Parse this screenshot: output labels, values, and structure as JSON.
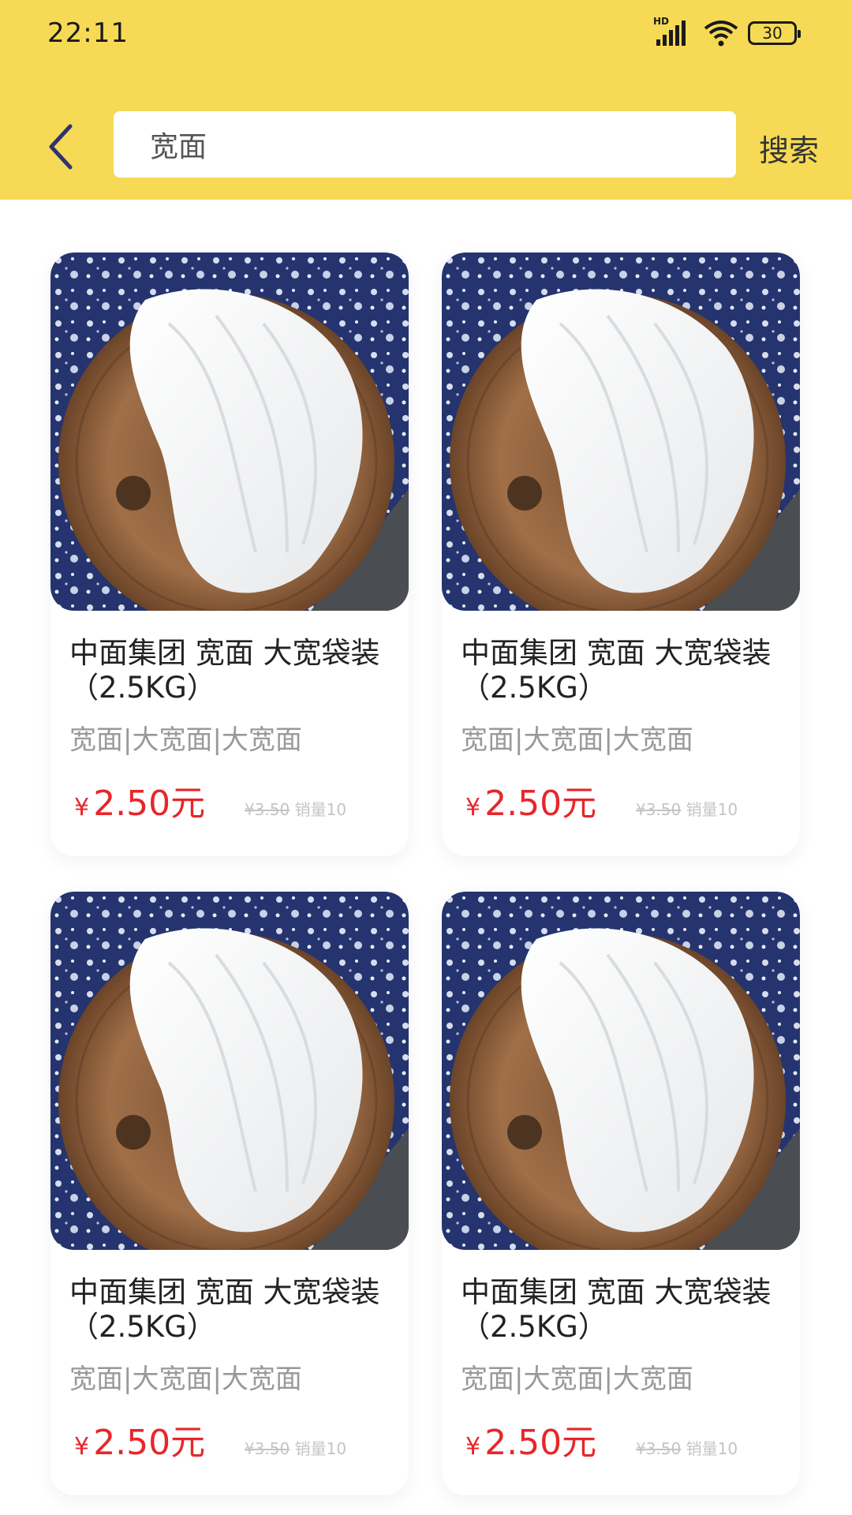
{
  "status_bar": {
    "time": "22:11",
    "network_label": "HD",
    "battery_level": "30"
  },
  "header": {
    "back_icon": "chevron-left-icon",
    "search_value": "宽面",
    "search_button_label": "搜索",
    "background_color": "#F6DA55"
  },
  "products": [
    {
      "title": "中面集团 宽面 大宽袋装（2.5KG）",
      "tags": "宽面|大宽面|大宽面",
      "price_symbol": "¥",
      "price_amount": "2.50元",
      "original_price": "¥3.50",
      "sales": "销量10"
    },
    {
      "title": "中面集团 宽面 大宽袋装（2.5KG）",
      "tags": "宽面|大宽面|大宽面",
      "price_symbol": "¥",
      "price_amount": "2.50元",
      "original_price": "¥3.50",
      "sales": "销量10"
    },
    {
      "title": "中面集团 宽面 大宽袋装（2.5KG）",
      "tags": "宽面|大宽面|大宽面",
      "price_symbol": "¥",
      "price_amount": "2.50元",
      "original_price": "¥3.50",
      "sales": "销量10"
    },
    {
      "title": "中面集团 宽面 大宽袋装（2.5KG）",
      "tags": "宽面|大宽面|大宽面",
      "price_symbol": "¥",
      "price_amount": "2.50元",
      "original_price": "¥3.50",
      "sales": "销量10"
    }
  ],
  "colors": {
    "price": "#E8262A",
    "accent": "#F6DA55",
    "tag_text": "#999999"
  }
}
